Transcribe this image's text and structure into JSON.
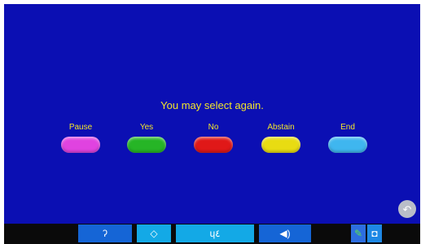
{
  "prompt": "You may select again.",
  "choices": [
    {
      "label": "Pause",
      "color": "#e043e0"
    },
    {
      "label": "Yes",
      "color": "#26b526"
    },
    {
      "label": "No",
      "color": "#e01818"
    },
    {
      "label": "Abstain",
      "color": "#e8dc12"
    },
    {
      "label": "End",
      "color": "#3fb6ef"
    }
  ],
  "taskbar": {
    "buttons": [
      {
        "icon": "ear-icon",
        "glyph": "ʔ"
      },
      {
        "icon": "diamond-icon",
        "glyph": "◇"
      },
      {
        "icon": "speech-icon",
        "glyph": "ɥ٤"
      },
      {
        "icon": "speaker-icon",
        "glyph": "◀)"
      },
      {
        "icon": "pen-icon",
        "glyph": "✎"
      },
      {
        "icon": "camera-icon",
        "glyph": "◘"
      }
    ]
  },
  "back_icon": "back-arrow-icon",
  "colors": {
    "background": "#0b0fb3",
    "text": "#f2e52b",
    "taskbar_button": "#1565d6",
    "taskbar_button_active": "#13a9e6"
  }
}
